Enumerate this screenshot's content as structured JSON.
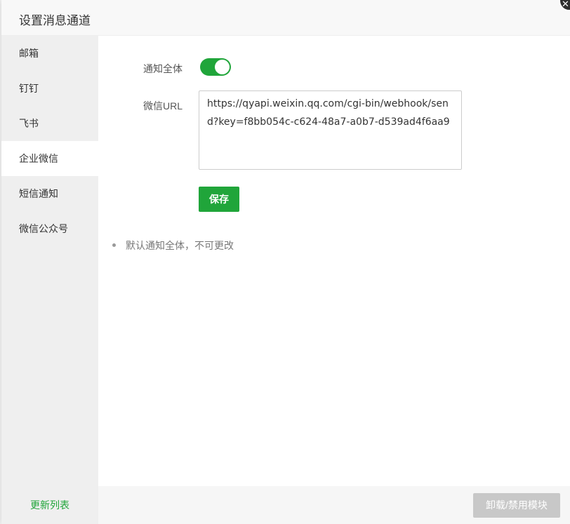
{
  "dialog": {
    "title": "设置消息通道"
  },
  "sidebar": {
    "items": [
      {
        "label": "邮箱"
      },
      {
        "label": "钉钉"
      },
      {
        "label": "飞书"
      },
      {
        "label": "企业微信"
      },
      {
        "label": "短信通知"
      },
      {
        "label": "微信公众号"
      }
    ],
    "active_index": 3,
    "footer_link": "更新列表"
  },
  "form": {
    "notify_all_label": "通知全体",
    "notify_all_enabled": true,
    "url_label": "微信URL",
    "url_value": "https://qyapi.weixin.qq.com/cgi-bin/webhook/send?key=f8bb054c-c624-48a7-a0b7-d539ad4f6aa9",
    "save_label": "保存"
  },
  "tips": [
    "默认通知全体，不可更改"
  ],
  "footer": {
    "uninstall_label": "卸载/禁用模块"
  },
  "colors": {
    "accent": "#20a53a",
    "disabled": "#c8c8c8"
  }
}
